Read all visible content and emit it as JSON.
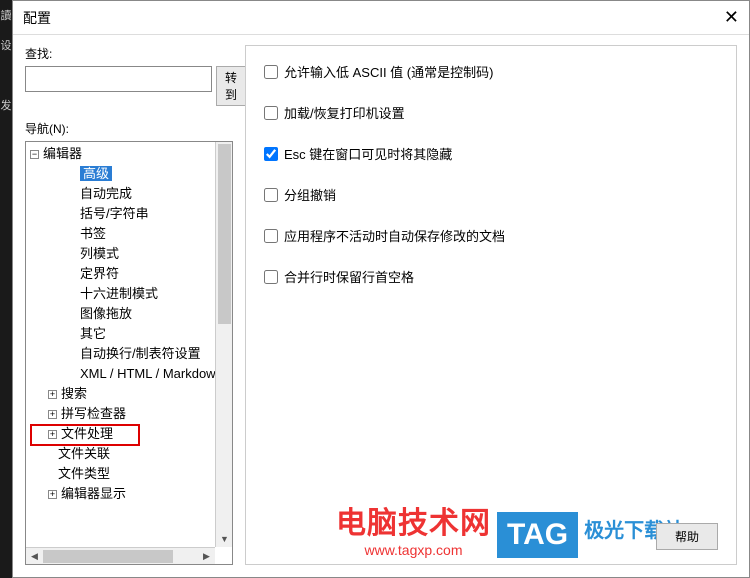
{
  "titlebar": {
    "title": "配置"
  },
  "search": {
    "label": "查找:",
    "value": "",
    "goto": "转到"
  },
  "nav": {
    "label": "导航(N):"
  },
  "tree": {
    "root": {
      "expander": "−",
      "label": "编辑器"
    },
    "children": [
      "高级",
      "自动完成",
      "括号/字符串",
      "书签",
      "列模式",
      "定界符",
      "十六进制模式",
      "图像拖放",
      "其它",
      "自动换行/制表符设置",
      "XML / HTML / Markdow"
    ],
    "siblings": [
      {
        "expander": "+",
        "label": "搜索"
      },
      {
        "expander": "+",
        "label": "拼写检查器"
      },
      {
        "expander": "+",
        "label": "文件处理"
      },
      {
        "expander": "",
        "label": "文件关联"
      },
      {
        "expander": "",
        "label": "文件类型"
      },
      {
        "expander": "+",
        "label": "编辑器显示"
      }
    ]
  },
  "options": [
    {
      "checked": false,
      "label": "允许输入低 ASCII 值 (通常是控制码)"
    },
    {
      "checked": false,
      "label": "加载/恢复打印机设置"
    },
    {
      "checked": true,
      "label": "Esc 键在窗口可见时将其隐藏"
    },
    {
      "checked": false,
      "label": "分组撤销"
    },
    {
      "checked": false,
      "label": "应用程序不活动时自动保存修改的文档"
    },
    {
      "checked": false,
      "label": "合并行时保留行首空格"
    }
  ],
  "help": "帮助",
  "watermark": {
    "site1_top": "电脑技术网",
    "site1_bottom": "www.tagxp.com",
    "tag": "TAG",
    "site2": "极光下载站"
  }
}
